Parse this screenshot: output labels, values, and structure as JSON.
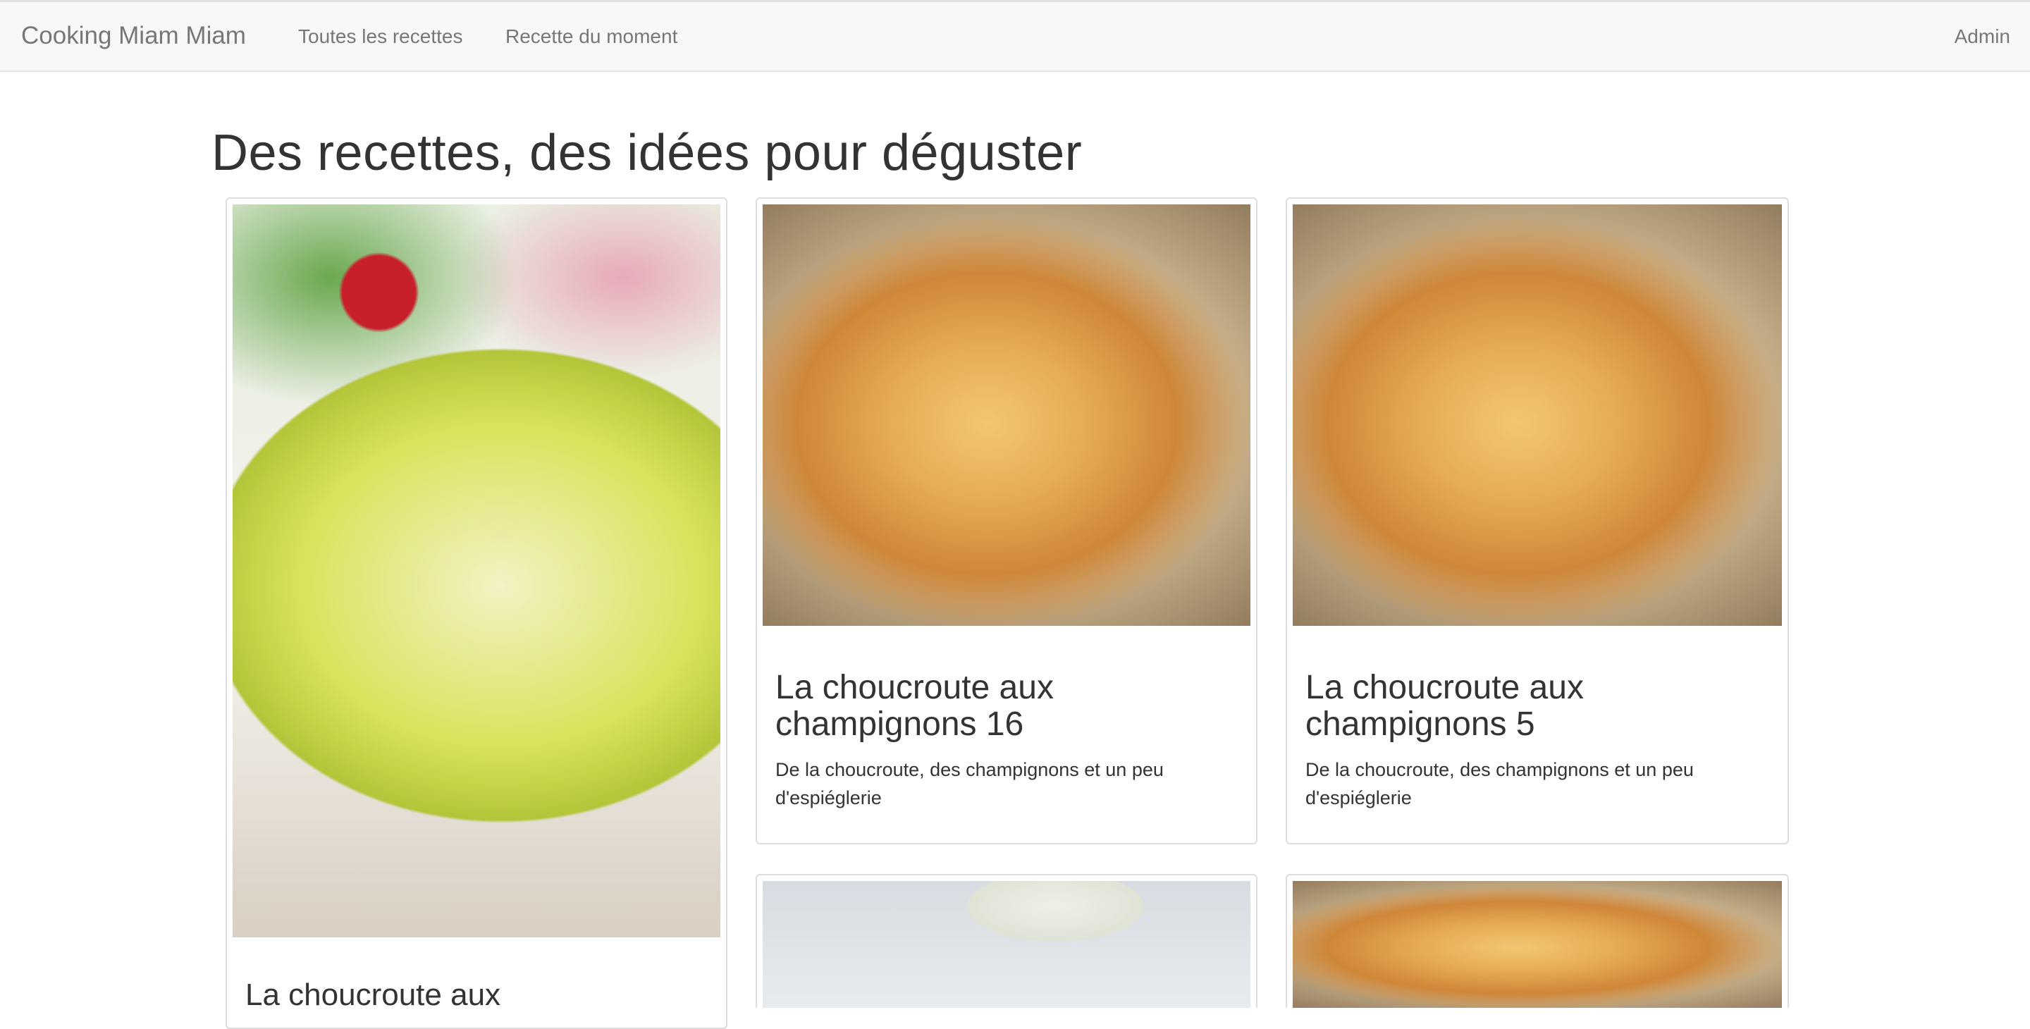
{
  "navbar": {
    "brand": "Cooking Miam Miam",
    "links": [
      "Toutes les recettes",
      "Recette du moment"
    ],
    "admin": "Admin"
  },
  "main": {
    "title": "Des recettes, des idées pour déguster"
  },
  "cards": [
    {
      "title": "La choucroute aux",
      "description": "",
      "image": "salad-photo"
    },
    {
      "title": "La choucroute aux champignons 16",
      "description": "De la choucroute, des champignons et un peu d'espiéglerie",
      "image": "gratin-photo"
    },
    {
      "title": "La choucroute aux champignons 5",
      "description": "De la choucroute, des champignons et un peu d'espiéglerie",
      "image": "gratin-photo"
    },
    {
      "title": "",
      "description": "",
      "image": "glass-photo"
    },
    {
      "title": "",
      "description": "",
      "image": "gratin-photo"
    }
  ],
  "colors": {
    "navbar_bg": "#f8f8f8",
    "nav_text": "#777777",
    "text": "#333333",
    "card_border": "#dddddd"
  }
}
